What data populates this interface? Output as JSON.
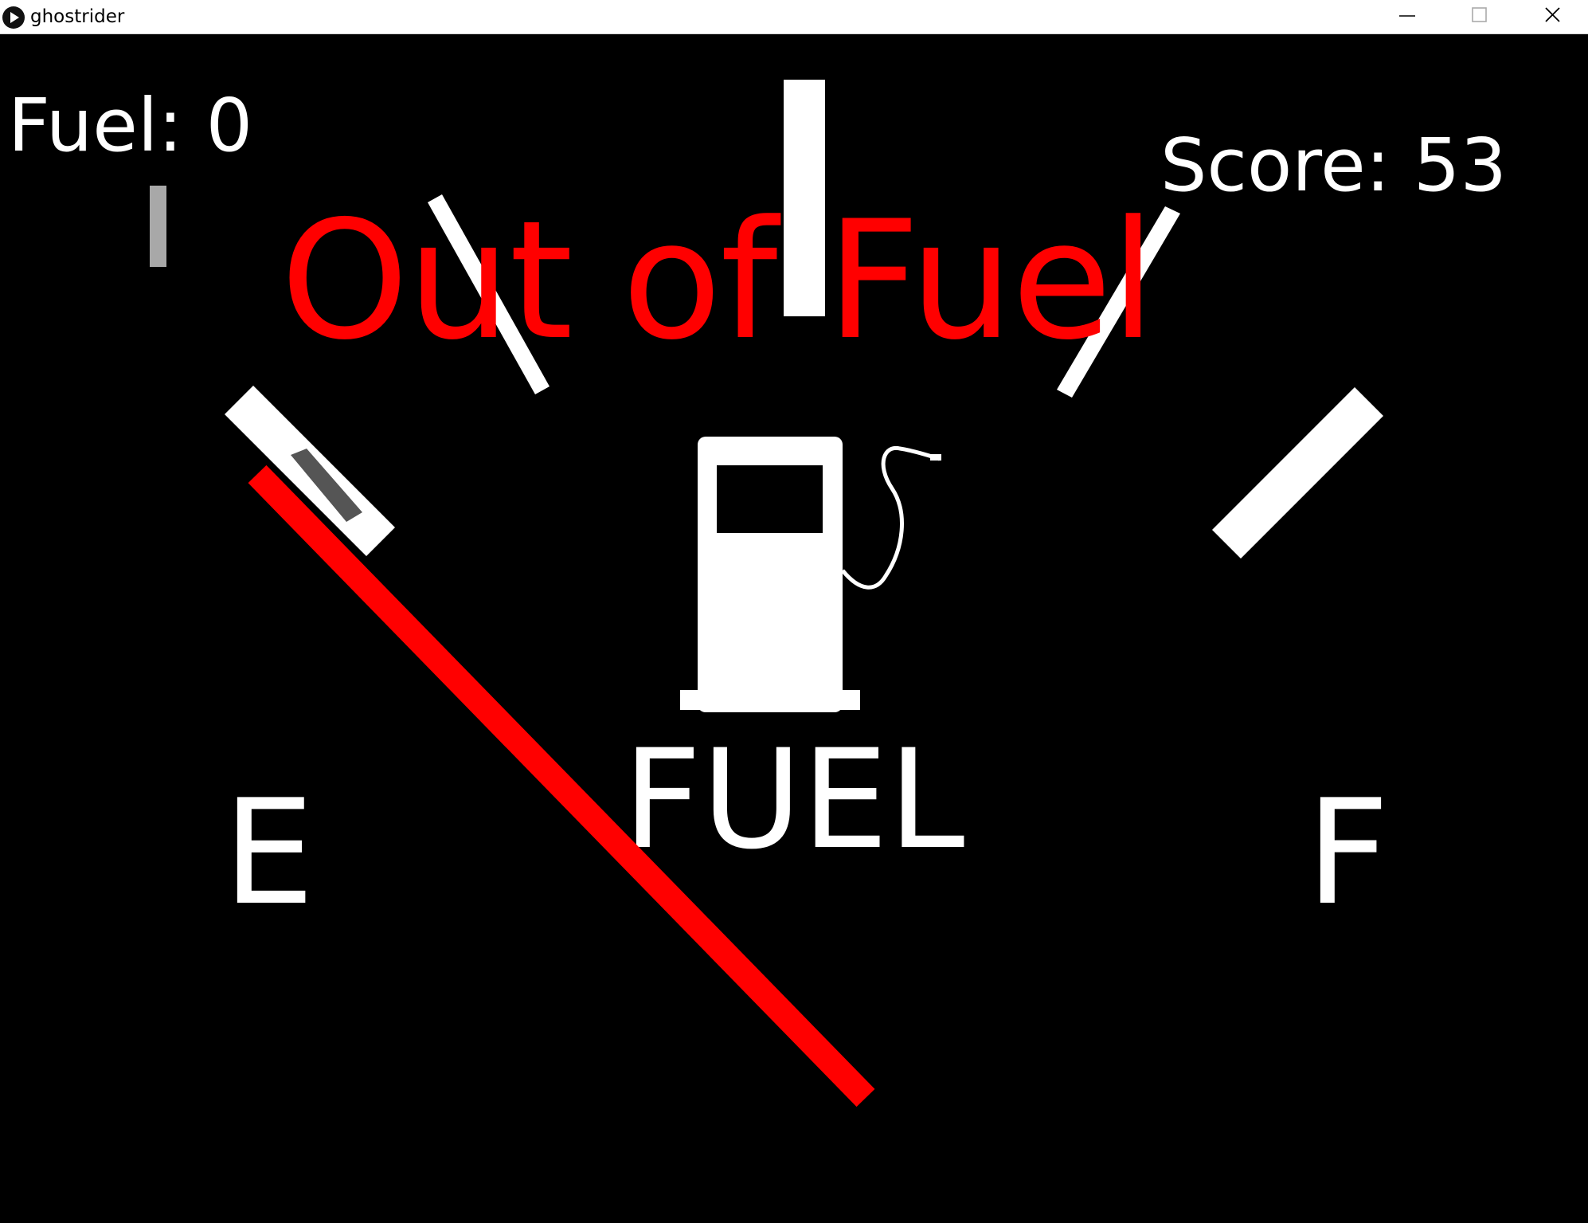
{
  "window": {
    "title": "ghostrider",
    "icon": "play-circle-icon",
    "controls": [
      "minimize-icon",
      "maximize-icon",
      "close-icon"
    ]
  },
  "hud": {
    "fuel_label": "Fuel: 0",
    "score_label": "Score: 53",
    "fuel_value": 0,
    "score_value": 53
  },
  "banner": {
    "text": "Out of Fuel",
    "color": "#ff0000"
  },
  "gauge": {
    "empty_label": "E",
    "full_label": "F",
    "caption": "FUEL",
    "icon": "fuel-pump-icon",
    "needle_color": "#ff0000",
    "needle_level": 0,
    "marks_color": "#ffffff"
  }
}
